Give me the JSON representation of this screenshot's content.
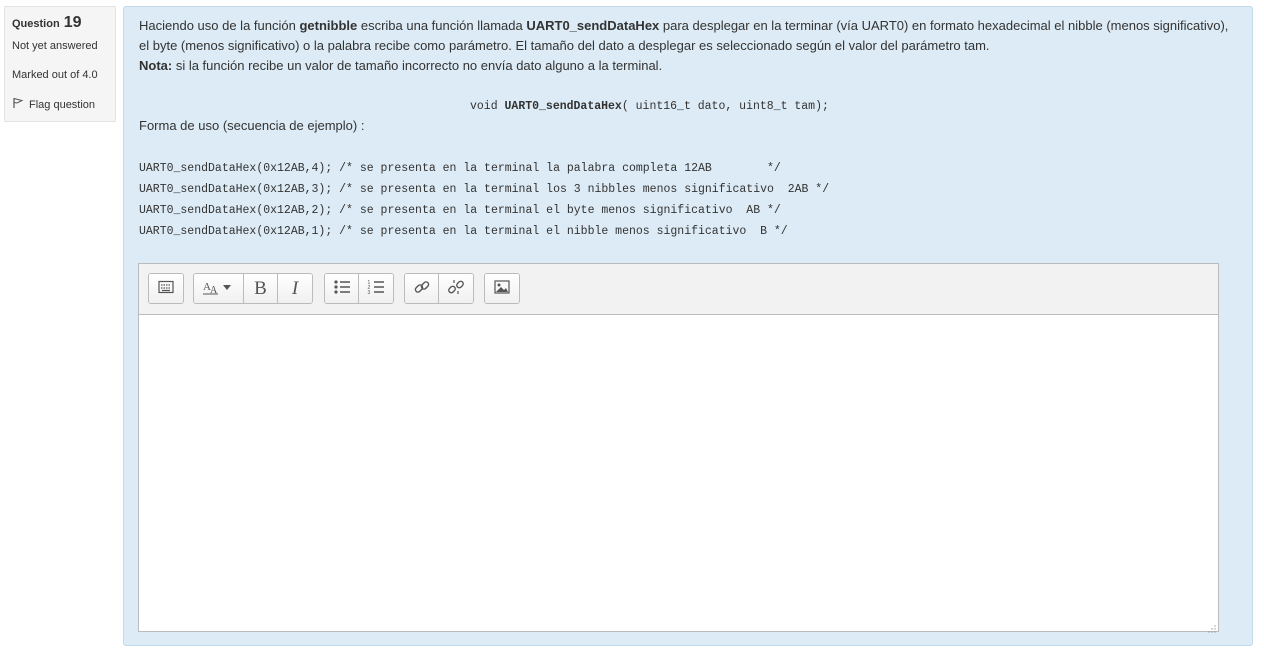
{
  "info": {
    "question_label": "Question",
    "question_number": "19",
    "state": "Not yet answered",
    "grade": "Marked out of 4.0",
    "flag_label": "Flag question"
  },
  "question": {
    "para1": "Haciendo uso de la función ",
    "bold1": "getnibble",
    "para2": " escriba una función llamada ",
    "bold2": "UART0_sendDataHex",
    "para3": " para desplegar en la terminar (vía UART0) en formato hexadecimal el nibble (menos significativo), el byte (menos significativo) o la palabra recibe como parámetro. El tamaño del dato a desplegar es seleccionado según el valor del parámetro tam.",
    "nota_label": "Nota:",
    "nota_text": " si la función recibe un valor de tamaño incorrecto no envía dato alguno a la terminal.",
    "sig_prefix": "void ",
    "sig_name": "UART0_sendDataHex",
    "sig_suffix": "( uint16_t dato, uint8_t tam);",
    "usage_label": "Forma de uso (secuencia de ejemplo) :",
    "code_lines": [
      "UART0_sendDataHex(0x12AB,4); /* se presenta en la terminal la palabra completa 12AB        */",
      "UART0_sendDataHex(0x12AB,3); /* se presenta en la terminal los 3 nibbles menos significativo  2AB */",
      "UART0_sendDataHex(0x12AB,2); /* se presenta en la terminal el byte menos significativo  AB */",
      "UART0_sendDataHex(0x12AB,1); /* se presenta en la terminal el nibble menos significativo  B */"
    ]
  },
  "editor": {
    "toolbar": [
      "toolbar-toggle",
      "font-style",
      "bold",
      "italic",
      "unordered-list",
      "ordered-list",
      "link",
      "unlink",
      "image"
    ],
    "bold_glyph": "B",
    "italic_glyph": "I",
    "answer_text": ""
  },
  "colors": {
    "content_bg": "#dcebf5",
    "info_bg": "#f5f5f5",
    "toolbar_bg": "#f2f2f2"
  }
}
